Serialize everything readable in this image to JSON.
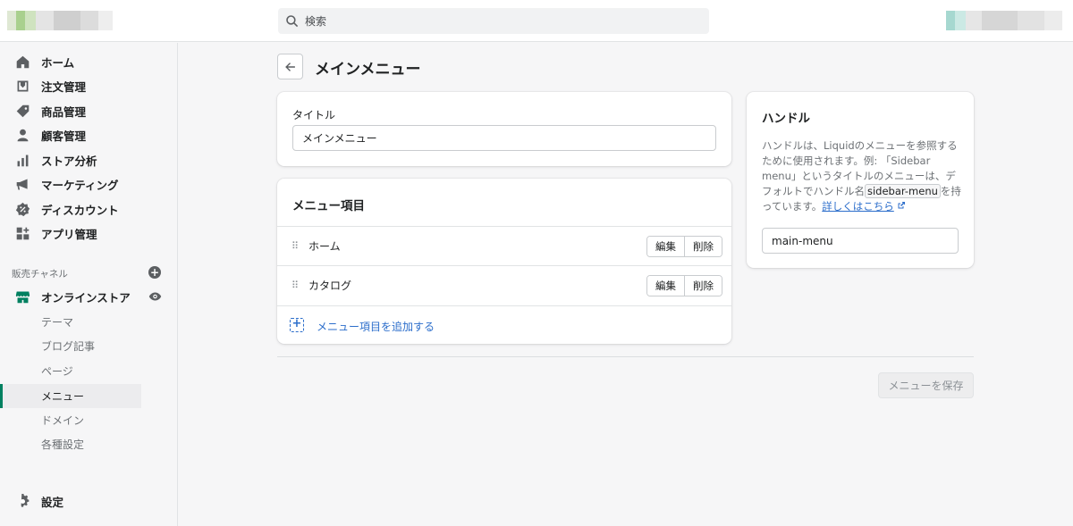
{
  "search": {
    "placeholder": "検索"
  },
  "sidebar": {
    "items": [
      {
        "label": "ホーム",
        "icon": "home-icon"
      },
      {
        "label": "注文管理",
        "icon": "orders-icon"
      },
      {
        "label": "商品管理",
        "icon": "tag-icon"
      },
      {
        "label": "顧客管理",
        "icon": "customer-icon"
      },
      {
        "label": "ストア分析",
        "icon": "analytics-icon"
      },
      {
        "label": "マーケティング",
        "icon": "megaphone-icon"
      },
      {
        "label": "ディスカウント",
        "icon": "discount-icon"
      },
      {
        "label": "アプリ管理",
        "icon": "apps-icon"
      }
    ],
    "channels_label": "販売チャネル",
    "online_store": "オンラインストア",
    "sub_items": [
      "テーマ",
      "ブログ記事",
      "ページ",
      "メニュー",
      "ドメイン",
      "各種設定"
    ],
    "active_sub_item": "メニュー",
    "settings": "設定"
  },
  "page": {
    "title": "メインメニュー"
  },
  "title_card": {
    "label": "タイトル",
    "value": "メインメニュー"
  },
  "menu_card": {
    "heading": "メニュー項目",
    "items": [
      {
        "label": "ホーム",
        "edit": "編集",
        "delete": "削除"
      },
      {
        "label": "カタログ",
        "edit": "編集",
        "delete": "削除"
      }
    ],
    "add_label": "メニュー項目を追加する"
  },
  "handle_card": {
    "heading": "ハンドル",
    "desc_part1": "ハンドルは、Liquidのメニューを参照するために使用されます。例: 「Sidebar menu」というタイトルのメニューは、デフォルトでハンドル名",
    "code": "sidebar-menu",
    "desc_part2": "を持っています。",
    "link": "詳しくはこちら",
    "value": "main-menu"
  },
  "save_button": "メニューを保存",
  "colors": {
    "accent": "#008060",
    "link": "#2c6ecb",
    "background": "#f6f6f7"
  }
}
